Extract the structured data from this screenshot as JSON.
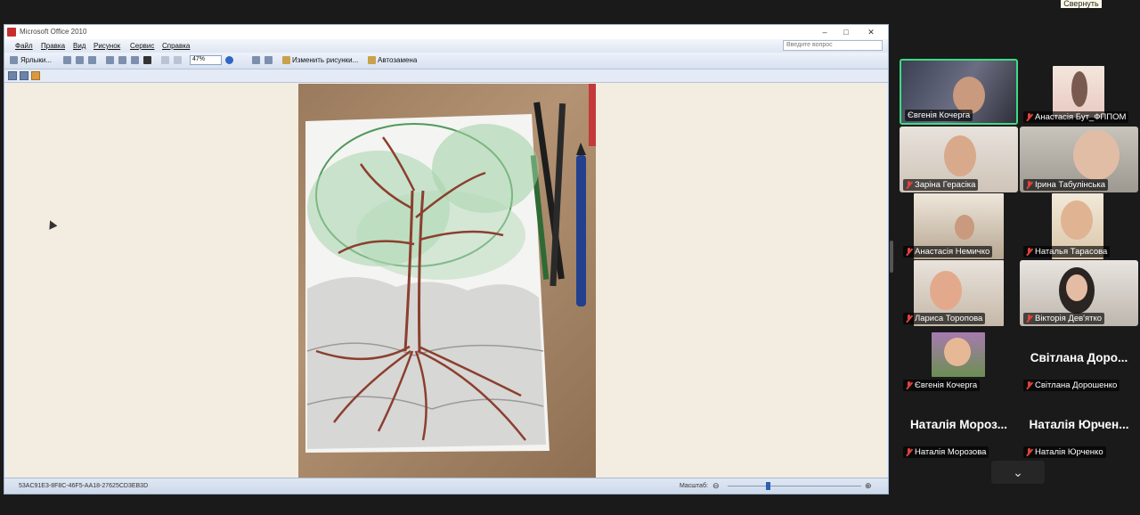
{
  "office": {
    "title": "Microsoft Office 2010",
    "menu": [
      "Файл",
      "Правка",
      "Вид",
      "Рисунок",
      "Сервис",
      "Справка"
    ],
    "ask_placeholder": "Введите вопрос",
    "toolbar": {
      "shortcuts_label": "Ярлыки...",
      "zoom_value": "47%",
      "edit_pictures_label": "Изменить рисунки...",
      "autocorrect_label": "Автозамена"
    },
    "status": {
      "file_id": "53AC91E3-8F8C-46F5-AA18-27625CD3EB3D",
      "zoom_label": "Масштаб:",
      "zoom_level": 0.3
    }
  },
  "meeting": {
    "collapse_label": "Свернуть",
    "more_label": "⌄",
    "participants": [
      {
        "name": "Євгенія Кочерга",
        "active": true,
        "muted": false,
        "video": true
      },
      {
        "name": "Анастасія Бут_ФППОМ",
        "active": false,
        "muted": true,
        "video": true
      },
      {
        "name": "Заріна Герасіка",
        "active": false,
        "muted": true,
        "video": true
      },
      {
        "name": "Ірина Табулінська",
        "active": false,
        "muted": true,
        "video": true
      },
      {
        "name": "Анастасія Немичко",
        "active": false,
        "muted": true,
        "video": true
      },
      {
        "name": "Наталья Тарасова",
        "active": false,
        "muted": true,
        "video": true
      },
      {
        "name": "Лариса Торопова",
        "active": false,
        "muted": true,
        "video": true
      },
      {
        "name": "Вікторія Дев'ятко",
        "active": false,
        "muted": true,
        "video": true
      },
      {
        "name": "Євгенія Кочерга",
        "active": false,
        "muted": true,
        "video": true
      },
      {
        "name": "Світлана Дорошенко",
        "display": "Світлана Доро...",
        "active": false,
        "muted": true,
        "video": false
      },
      {
        "name": "Наталія Морозова",
        "display": "Наталія Мороз...",
        "active": false,
        "muted": true,
        "video": false
      },
      {
        "name": "Наталія Юрченко",
        "display": "Наталія Юрчен...",
        "active": false,
        "muted": true,
        "video": false
      }
    ]
  },
  "colors": {
    "active_border": "#3ddc84",
    "mic_muted": "#e0433c",
    "office_chrome": "#e9eef7",
    "canvas": "#f3ede1"
  }
}
